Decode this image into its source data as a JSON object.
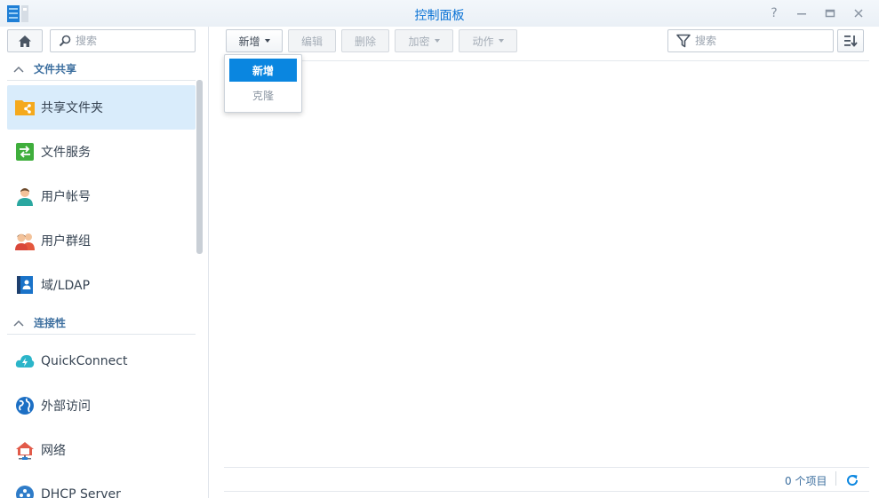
{
  "window": {
    "title": "控制面板",
    "controls": [
      "help-icon",
      "minimize-icon",
      "maximize-icon",
      "close-icon"
    ],
    "help_glyph": "?"
  },
  "sidebar": {
    "search_placeholder": "搜索",
    "sections": [
      {
        "label": "文件共享",
        "items": [
          {
            "label": "共享文件夹",
            "icon": "shared-folder-icon",
            "active": true
          },
          {
            "label": "文件服务",
            "icon": "file-services-icon"
          },
          {
            "label": "用户帐号",
            "icon": "user-icon"
          },
          {
            "label": "用户群组",
            "icon": "group-icon"
          },
          {
            "label": "域/LDAP",
            "icon": "domain-ldap-icon"
          }
        ]
      },
      {
        "label": "连接性",
        "items": [
          {
            "label": "QuickConnect",
            "icon": "quickconnect-icon"
          },
          {
            "label": "外部访问",
            "icon": "external-access-icon"
          },
          {
            "label": "网络",
            "icon": "network-icon"
          },
          {
            "label": "DHCP Server",
            "icon": "dhcp-server-icon"
          }
        ]
      }
    ]
  },
  "toolbar": {
    "create_label": "新增",
    "edit_label": "编辑",
    "delete_label": "删除",
    "encrypt_label": "加密",
    "action_label": "动作",
    "filter_placeholder": "搜索"
  },
  "dropdown": {
    "items": [
      {
        "label": "新增",
        "selected": true
      },
      {
        "label": "克隆",
        "selected": false
      }
    ]
  },
  "footer": {
    "count_text": "0 个项目"
  },
  "colors": {
    "accent": "#0a86e0",
    "title": "#0b73d5",
    "active_bg": "#d9ecfb"
  }
}
